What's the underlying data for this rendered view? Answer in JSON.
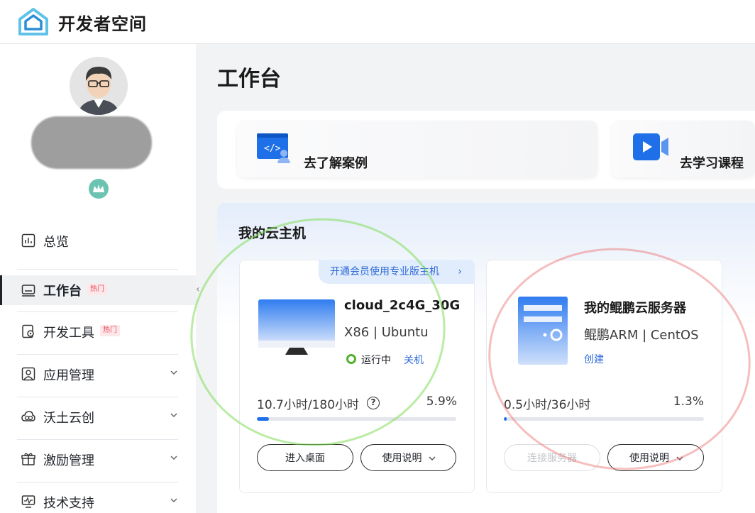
{
  "app": {
    "title": "开发者空间"
  },
  "sidebar": {
    "items": [
      {
        "label": "总览",
        "icon": "chart-icon"
      },
      {
        "label": "工作台",
        "icon": "keyboard-icon",
        "tag": "热门",
        "active": true
      },
      {
        "label": "开发工具",
        "icon": "dev-tool-icon",
        "tag": "热门"
      },
      {
        "label": "应用管理",
        "icon": "app-manage-icon"
      },
      {
        "label": "沃土云创",
        "icon": "cloud-icon"
      },
      {
        "label": "激励管理",
        "icon": "gift-icon"
      },
      {
        "label": "技术支持",
        "icon": "support-icon"
      }
    ]
  },
  "main": {
    "page_title": "工作台",
    "quick_links": [
      {
        "label": "去了解案例",
        "icon": "code-user-icon"
      },
      {
        "label": "去学习课程",
        "icon": "video-play-icon"
      }
    ],
    "vm_section": {
      "title": "我的云主机",
      "promo": "开通会员使用专业版主机",
      "hosts": [
        {
          "name": "cloud_2c4G_30G",
          "spec": "X86 | Ubuntu",
          "status": "运行中",
          "action_link": "关机",
          "usage": "10.7小时/180小时",
          "percent": "5.9%",
          "usage_fraction": 0.059,
          "primary_button": "进入桌面",
          "secondary_button": "使用说明",
          "primary_enabled": true
        },
        {
          "name": "我的鲲鹏云服务器",
          "spec": "鲲鹏ARM | CentOS",
          "action_link": "创建",
          "usage": "0.5小时/36小时",
          "percent": "1.3%",
          "usage_fraction": 0.013,
          "primary_button": "连接服务器",
          "secondary_button": "使用说明",
          "primary_enabled": false
        }
      ]
    }
  },
  "colors": {
    "accent": "#1e6fe8",
    "link": "#2f6bd9",
    "status_running": "#52b130",
    "hot_tag": "#e34d59"
  }
}
